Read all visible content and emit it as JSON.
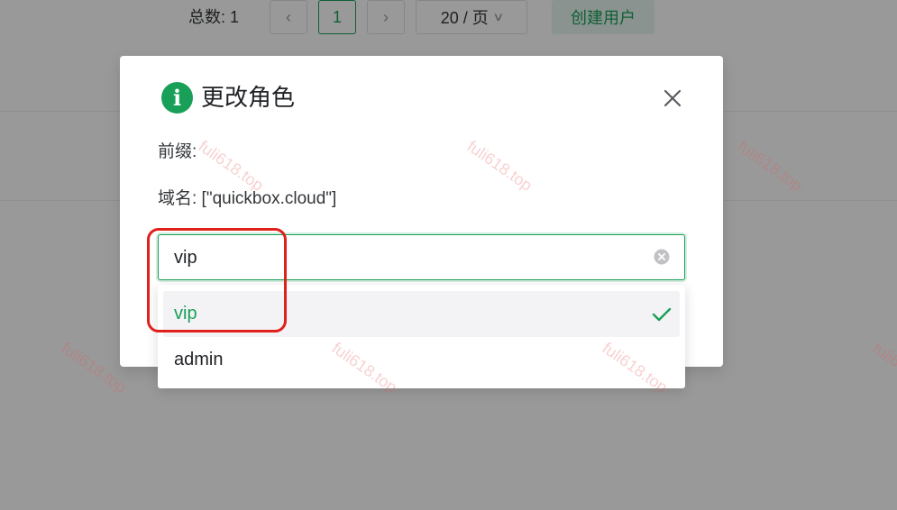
{
  "pagination": {
    "total_label": "总数: 1",
    "prev_icon": "chevron-left-icon",
    "current_page": "1",
    "next_icon": "chevron-right-icon",
    "page_size": "20 / 页"
  },
  "create_user_label": "创建用户",
  "dialog": {
    "icon": "info-icon",
    "icon_glyph": "i",
    "title": "更改角色",
    "prefix_line": "前缀:",
    "domain_line": "域名: [\"quickbox.cloud\"]"
  },
  "role_select": {
    "value": "vip",
    "options": [
      {
        "label": "vip",
        "selected": true
      },
      {
        "label": "admin",
        "selected": false
      }
    ]
  },
  "colors": {
    "accent": "#18a058",
    "annotation": "#e0201b"
  },
  "watermark": "fuli618.top"
}
